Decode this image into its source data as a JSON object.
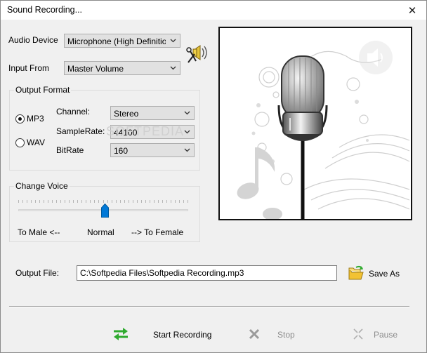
{
  "window": {
    "title": "Sound Recording...",
    "close_glyph": "✕"
  },
  "audio_device": {
    "label": "Audio Device",
    "value": "Microphone (High Definition A"
  },
  "input_from": {
    "label": "Input From",
    "value": "Master Volume"
  },
  "output_format": {
    "title": "Output Format",
    "mp3_label": "MP3",
    "wav_label": "WAV",
    "selected": "MP3",
    "channel": {
      "label": "Channel:",
      "value": "Stereo"
    },
    "samplerate": {
      "label": "SampleRate:",
      "value": "44100"
    },
    "bitrate": {
      "label": "BitRate",
      "value": "160"
    }
  },
  "change_voice": {
    "title": "Change Voice",
    "left_label": "To Male <--",
    "center_label": "Normal",
    "right_label": "--> To Female",
    "level": 0.5
  },
  "output_file": {
    "label": "Output File:",
    "value": "C:\\Softpedia Files\\Softpedia Recording.mp3"
  },
  "buttons": {
    "save_as": "Save As",
    "start_recording": "Start Recording",
    "stop": "Stop",
    "pause": "Pause"
  },
  "watermark": "SOFTPEDIA",
  "colors": {
    "accent_blue": "#0078d7",
    "arrow_green": "#2faa2f",
    "folder_yellow": "#f2c233"
  },
  "icons": [
    "speaker-tuning-icon",
    "microphone-illustration",
    "folder-open-icon",
    "swap-arrows-icon",
    "stop-x-icon",
    "pause-arrows-icon"
  ]
}
